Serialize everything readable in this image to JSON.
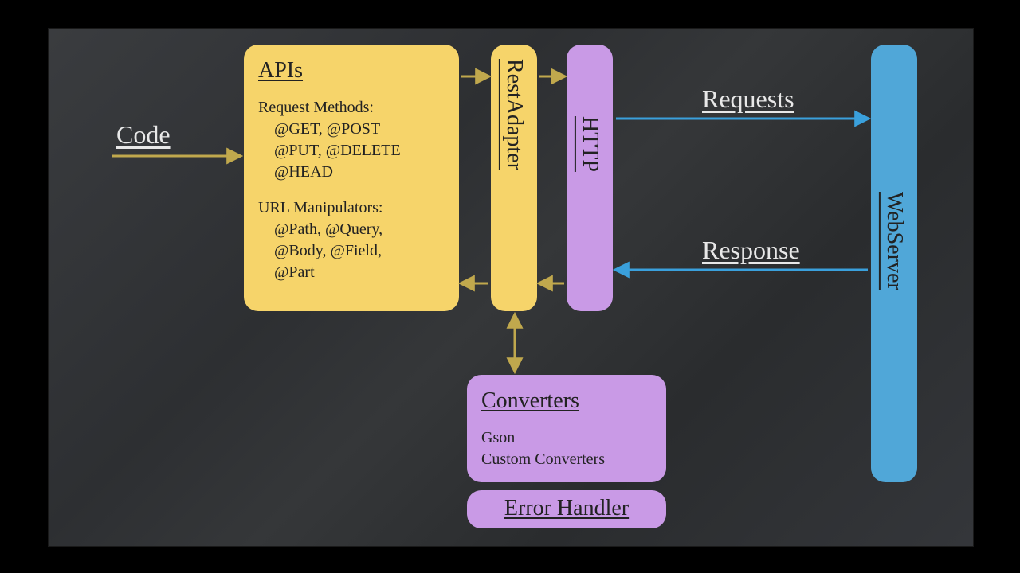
{
  "labels": {
    "code": "Code",
    "requests": "Requests",
    "response": "Response"
  },
  "apis": {
    "title": "APIs",
    "reqMethodsHeading": "Request Methods:",
    "reqMethods1": "@GET, @POST",
    "reqMethods2": "@PUT, @DELETE",
    "reqMethods3": "@HEAD",
    "urlHeading": "URL Manipulators:",
    "url1": "@Path, @Query,",
    "url2": "@Body, @Field,",
    "url3": "@Part"
  },
  "restAdapter": {
    "title": "RestAdapter"
  },
  "http": {
    "title": "HTTP"
  },
  "webserver": {
    "title": "WebServer"
  },
  "converters": {
    "title": "Converters",
    "l1": "Gson",
    "l2": "Custom Converters"
  },
  "errorHandler": {
    "title": "Error Handler"
  },
  "colors": {
    "arrowYellow": "#c0a84d",
    "arrowBlue": "#3aa0dc"
  }
}
